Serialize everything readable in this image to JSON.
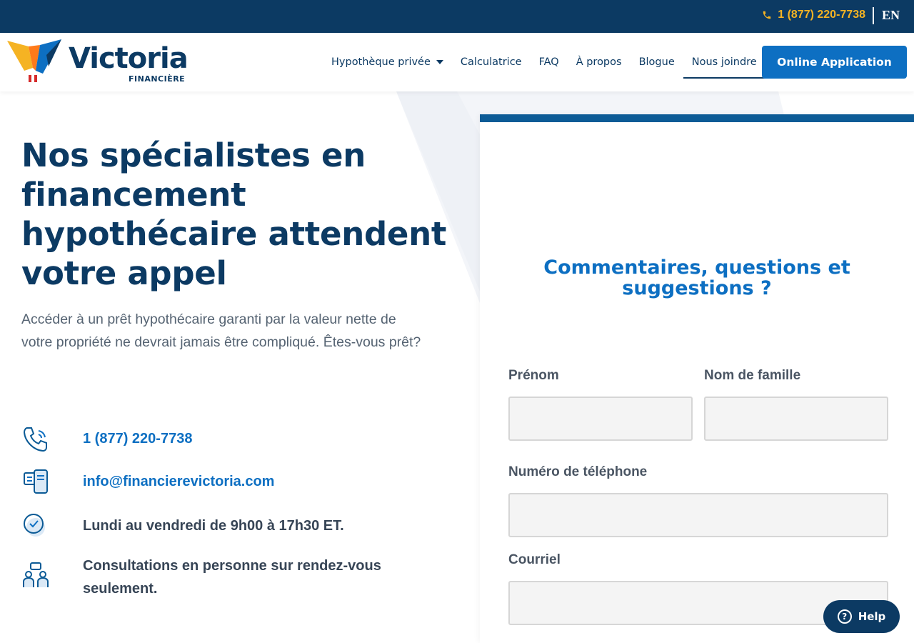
{
  "topbar": {
    "phone": "1 (877) 220-7738",
    "language": "EN"
  },
  "logo": {
    "brand": "Victoria",
    "sub": "FINANCIÈRE"
  },
  "nav": {
    "items": [
      {
        "label": "Hypothèque privée"
      },
      {
        "label": "Calculatrice"
      },
      {
        "label": "FAQ"
      },
      {
        "label": "À propos"
      },
      {
        "label": "Blogue"
      },
      {
        "label": "Nous joindre"
      }
    ],
    "apply_label": "Online Application"
  },
  "hero": {
    "title": "Nos spécialistes en financement hypothécaire attendent votre appel",
    "text": "Accéder à un prêt hypothécaire garanti par la valeur nette de votre propriété ne devrait jamais être compliqué. Êtes-vous prêt?"
  },
  "contact": {
    "phone": "1 (877) 220-7738",
    "email": "info@financierevictoria.com",
    "hours": "Lundi au vendredi de 9h00 à 17h30 ET.",
    "consult": "Consultations en personne sur rendez-vous seulement."
  },
  "form": {
    "title": "Commentaires, questions et suggestions ?",
    "first_name_label": "Prénom",
    "last_name_label": "Nom de famille",
    "phone_label": "Numéro de téléphone",
    "email_label": "Courriel"
  },
  "help": {
    "label": "Help"
  },
  "colors": {
    "navy": "#0c3a63",
    "accent_blue": "#0d6fc2",
    "gold": "#f5b323"
  }
}
